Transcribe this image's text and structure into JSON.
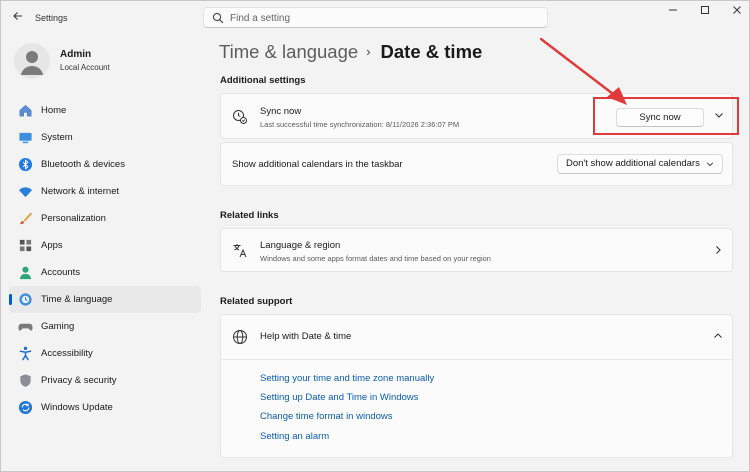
{
  "window": {
    "app_title": "Settings",
    "back_icon": "arrow-left-icon",
    "minimize_icon": "minimize-icon",
    "maximize_icon": "maximize-icon",
    "close_icon": "close-icon"
  },
  "search": {
    "placeholder": "Find a setting",
    "icon": "search-icon"
  },
  "profile": {
    "name": "Admin",
    "account_type": "Local Account"
  },
  "sidebar": {
    "items": [
      {
        "label": "Home",
        "icon": "home-icon",
        "active": false
      },
      {
        "label": "System",
        "icon": "monitor-icon",
        "active": false
      },
      {
        "label": "Bluetooth & devices",
        "icon": "bluetooth-icon",
        "active": false
      },
      {
        "label": "Network & internet",
        "icon": "wifi-icon",
        "active": false
      },
      {
        "label": "Personalization",
        "icon": "brush-icon",
        "active": false
      },
      {
        "label": "Apps",
        "icon": "apps-icon",
        "active": false
      },
      {
        "label": "Accounts",
        "icon": "person-icon",
        "active": false
      },
      {
        "label": "Time & language",
        "icon": "clock-globe-icon",
        "active": true
      },
      {
        "label": "Gaming",
        "icon": "gamepad-icon",
        "active": false
      },
      {
        "label": "Accessibility",
        "icon": "accessibility-icon",
        "active": false
      },
      {
        "label": "Privacy & security",
        "icon": "shield-icon",
        "active": false
      },
      {
        "label": "Windows Update",
        "icon": "update-icon",
        "active": false
      }
    ]
  },
  "breadcrumb": {
    "parent": "Time & language",
    "separator": "›",
    "current": "Date & time"
  },
  "additional_settings": {
    "title": "Additional settings",
    "sync": {
      "title": "Sync now",
      "subtitle": "Last successful time synchronization: 8/11/2026 2:36:07 PM",
      "button_label": "Sync now",
      "icon": "sync-clock-icon"
    },
    "calendars": {
      "label": "Show additional calendars in the taskbar",
      "selected": "Don't show additional calendars"
    }
  },
  "related_links": {
    "title": "Related links",
    "item": {
      "title": "Language & region",
      "subtitle": "Windows and some apps format dates and time based on your region",
      "icon": "language-icon"
    }
  },
  "related_support": {
    "title": "Related support",
    "help": {
      "title": "Help with Date & time",
      "icon": "globe-icon",
      "expanded": true,
      "links": [
        "Setting your time and time zone manually",
        "Setting up Date and Time in Windows",
        "Change time format in windows",
        "Setting an alarm"
      ]
    }
  },
  "annotation": {
    "highlight_color": "#e03a3a"
  },
  "colors": {
    "accent": "#005fb8",
    "link": "#0b5cad",
    "background": "#f3f3f3",
    "card": "#fbfbfb"
  }
}
